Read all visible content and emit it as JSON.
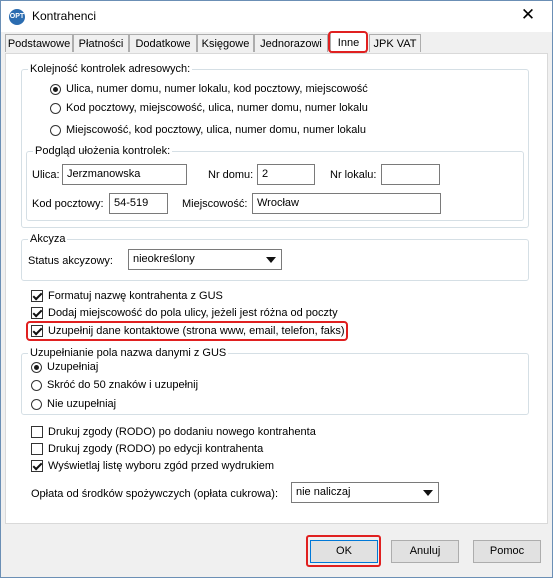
{
  "window": {
    "title": "Kontrahenci",
    "app_icon": "OPT",
    "close": "✕"
  },
  "tabs": [
    {
      "label": "Podstawowe",
      "active": false
    },
    {
      "label": "Płatności",
      "active": false
    },
    {
      "label": "Dodatkowe",
      "active": false
    },
    {
      "label": "Księgowe",
      "active": false
    },
    {
      "label": "Jednorazowi",
      "active": false
    },
    {
      "label": "Inne",
      "active": true
    },
    {
      "label": "JPK VAT",
      "active": false
    }
  ],
  "address_order": {
    "legend": "Kolejność kontrolek adresowych:",
    "options": [
      {
        "label": "Ulica, numer domu, numer lokalu, kod pocztowy, miejscowość",
        "selected": true
      },
      {
        "label": "Kod pocztowy, miejscowość, ulica, numer domu, numer lokalu",
        "selected": false
      },
      {
        "label": "Miejscowość, kod pocztowy, ulica, numer domu, numer lokalu",
        "selected": false
      }
    ],
    "preview": {
      "legend": "Podgląd ułożenia kontrolek:",
      "street_label": "Ulica:",
      "street_value": "Jerzmanowska",
      "house_label": "Nr domu:",
      "house_value": "2",
      "flat_label": "Nr lokalu:",
      "flat_value": "",
      "postal_label": "Kod pocztowy:",
      "postal_value": "54-519",
      "city_label": "Miejscowość:",
      "city_value": "Wrocław"
    }
  },
  "excise": {
    "legend": "Akcyza",
    "status_label": "Status akcyzowy:",
    "status_value": "nieokreślony"
  },
  "checks1": [
    {
      "label": "Formatuj nazwę kontrahenta z GUS",
      "checked": true
    },
    {
      "label": "Dodaj miejscowość do pola ulicy, jeżeli jest różna od poczty",
      "checked": true
    },
    {
      "label": "Uzupełnij dane kontaktowe (strona www, email, telefon, faks)",
      "checked": true
    }
  ],
  "gus_name": {
    "legend": "Uzupełnianie pola nazwa danymi z GUS",
    "options": [
      {
        "label": "Uzupełniaj",
        "selected": true
      },
      {
        "label": "Skróć do 50 znaków i uzupełnij",
        "selected": false
      },
      {
        "label": "Nie uzupełniaj",
        "selected": false
      }
    ]
  },
  "checks2": [
    {
      "label": "Drukuj zgody (RODO) po dodaniu nowego kontrahenta",
      "checked": false
    },
    {
      "label": "Drukuj zgody (RODO) po edycji kontrahenta",
      "checked": false
    },
    {
      "label": "Wyświetlaj listę wyboru zgód przed wydrukiem",
      "checked": true
    }
  ],
  "sugar_fee": {
    "label": "Opłata od środków spożywczych (opłata cukrowa):",
    "value": "nie naliczaj"
  },
  "buttons": {
    "ok": "OK",
    "cancel": "Anuluj",
    "help": "Pomoc"
  }
}
